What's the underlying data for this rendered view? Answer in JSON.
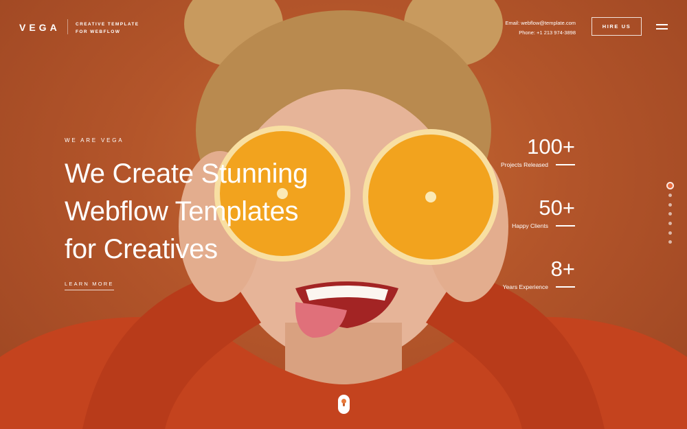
{
  "header": {
    "logo": "VEGA",
    "tagline_line1": "CREATIVE TEMPLATE",
    "tagline_line2": "FOR WEBFLOW",
    "email": "Email:  webflow@template.com",
    "phone": "Phone: +1 213 974-3898",
    "hire_label": "HIRE US"
  },
  "hero": {
    "eyebrow": "WE ARE VEGA",
    "headline_line1": "We Create Stunning",
    "headline_line2": "Webflow Templates",
    "headline_line3": "for Creatives",
    "cta_label": "LEARN MORE"
  },
  "stats": [
    {
      "value": "100+",
      "label": "Projects Released"
    },
    {
      "value": "50+",
      "label": "Happy Clients"
    },
    {
      "value": "8+",
      "label": "Years Experience"
    }
  ],
  "slider": {
    "total_slides": 7,
    "active_slide": 1
  },
  "colors": {
    "background": "#b8562a",
    "sweater": "#c4431e",
    "orange": "#f2a31e",
    "accent": "#e86a3c"
  },
  "icons": {
    "menu": "hamburger-icon",
    "scroll": "mouse-scroll-icon"
  }
}
